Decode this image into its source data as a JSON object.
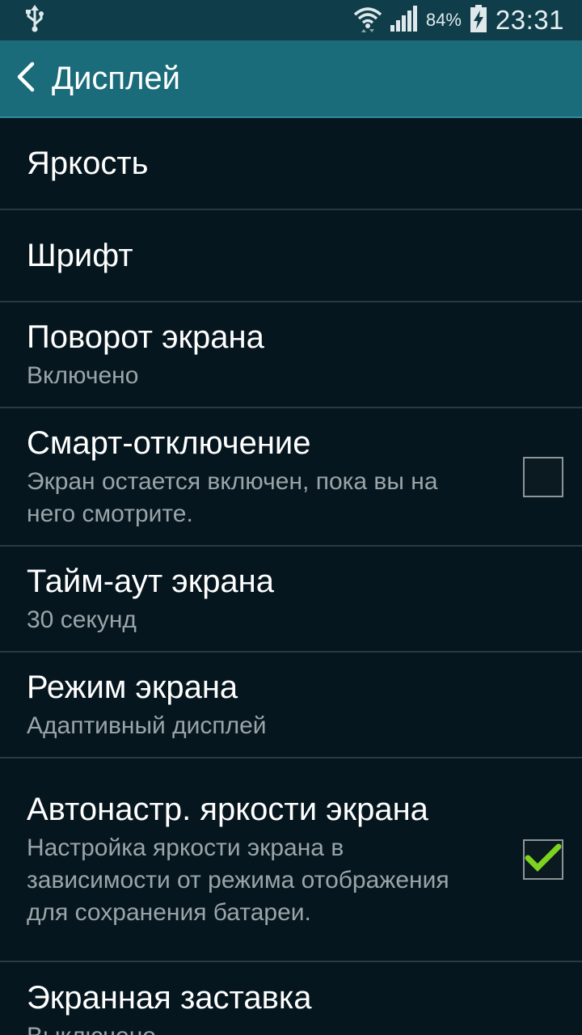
{
  "status_bar": {
    "usb_icon": "usb-icon",
    "wifi_icon": "wifi-icon",
    "signal_icon": "signal-icon",
    "battery_percent": "84%",
    "battery_icon": "battery-charging-icon",
    "time": "23:31"
  },
  "header": {
    "back_icon": "back-arrow-icon",
    "title": "Дисплей"
  },
  "settings": [
    {
      "title": "Яркость"
    },
    {
      "title": "Шрифт"
    },
    {
      "title": "Поворот экрана",
      "subtitle": "Включено"
    },
    {
      "title": "Смарт-отключение",
      "subtitle": "Экран остается включен, пока вы на него смотрите.",
      "checked": false
    },
    {
      "title": "Тайм-аут экрана",
      "subtitle": "30 секунд"
    },
    {
      "title": "Режим экрана",
      "subtitle": "Адаптивный дисплей"
    },
    {
      "title": "Автонастр. яркости экрана",
      "subtitle": "Настройка яркости экрана в зависимости от режима отображения для сохранения батареи.",
      "checked": true
    },
    {
      "title": "Экранная заставка",
      "subtitle": "Выключено"
    }
  ],
  "colors": {
    "background": "#06161e",
    "status_bar": "#0f3e4a",
    "action_bar": "#1b6c7a",
    "check_accent": "#7ed321",
    "subtitle_text": "#9aa5a9"
  }
}
